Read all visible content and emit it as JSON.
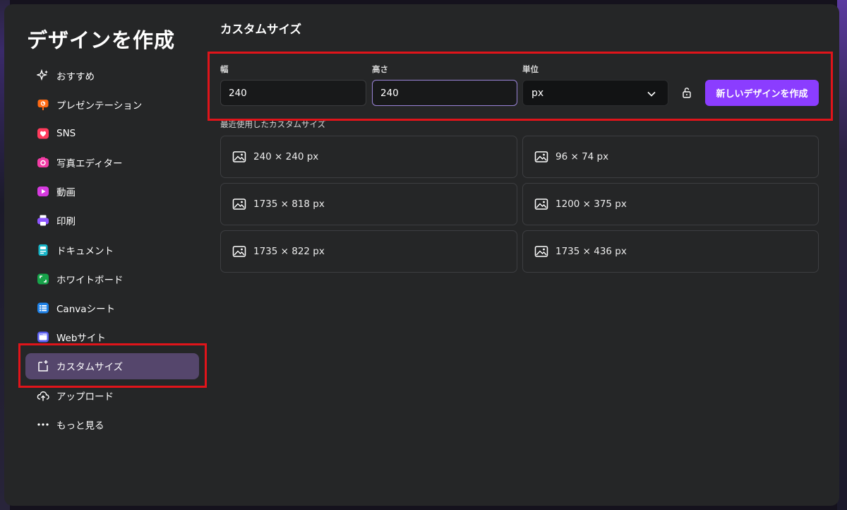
{
  "dialog": {
    "title": "デザインを作成"
  },
  "sidebar": {
    "items": [
      {
        "label": "おすすめ",
        "icon": "sparkle-icon"
      },
      {
        "label": "プレゼンテーション",
        "icon": "presentation-icon"
      },
      {
        "label": "SNS",
        "icon": "heart-icon"
      },
      {
        "label": "写真エディター",
        "icon": "camera-icon"
      },
      {
        "label": "動画",
        "icon": "video-icon"
      },
      {
        "label": "印刷",
        "icon": "printer-icon"
      },
      {
        "label": "ドキュメント",
        "icon": "document-icon"
      },
      {
        "label": "ホワイトボード",
        "icon": "whiteboard-icon"
      },
      {
        "label": "Canvaシート",
        "icon": "sheet-icon"
      },
      {
        "label": "Webサイト",
        "icon": "website-icon"
      },
      {
        "label": "カスタムサイズ",
        "icon": "custom-size-icon",
        "active": true
      },
      {
        "label": "アップロード",
        "icon": "upload-cloud-icon"
      },
      {
        "label": "もっと見る",
        "icon": "more-dots-icon"
      }
    ]
  },
  "main": {
    "title": "カスタムサイズ",
    "width_label": "幅",
    "width_value": "240",
    "height_label": "高さ",
    "height_value": "240",
    "unit_label": "単位",
    "unit_value": "px",
    "create_button": "新しいデザインを作成",
    "recent_heading": "最近使用したカスタムサイズ",
    "recent": [
      {
        "label": "240 × 240 px"
      },
      {
        "label": "96 × 74 px"
      },
      {
        "label": "1735 × 818 px"
      },
      {
        "label": "1200 × 375 px"
      },
      {
        "label": "1735 × 822 px"
      },
      {
        "label": "1735 × 436 px"
      }
    ]
  },
  "colors": {
    "accent": "#8b3dff",
    "active_nav": "#55466c",
    "highlight": "#e0141a",
    "dialog_bg": "#252627"
  }
}
